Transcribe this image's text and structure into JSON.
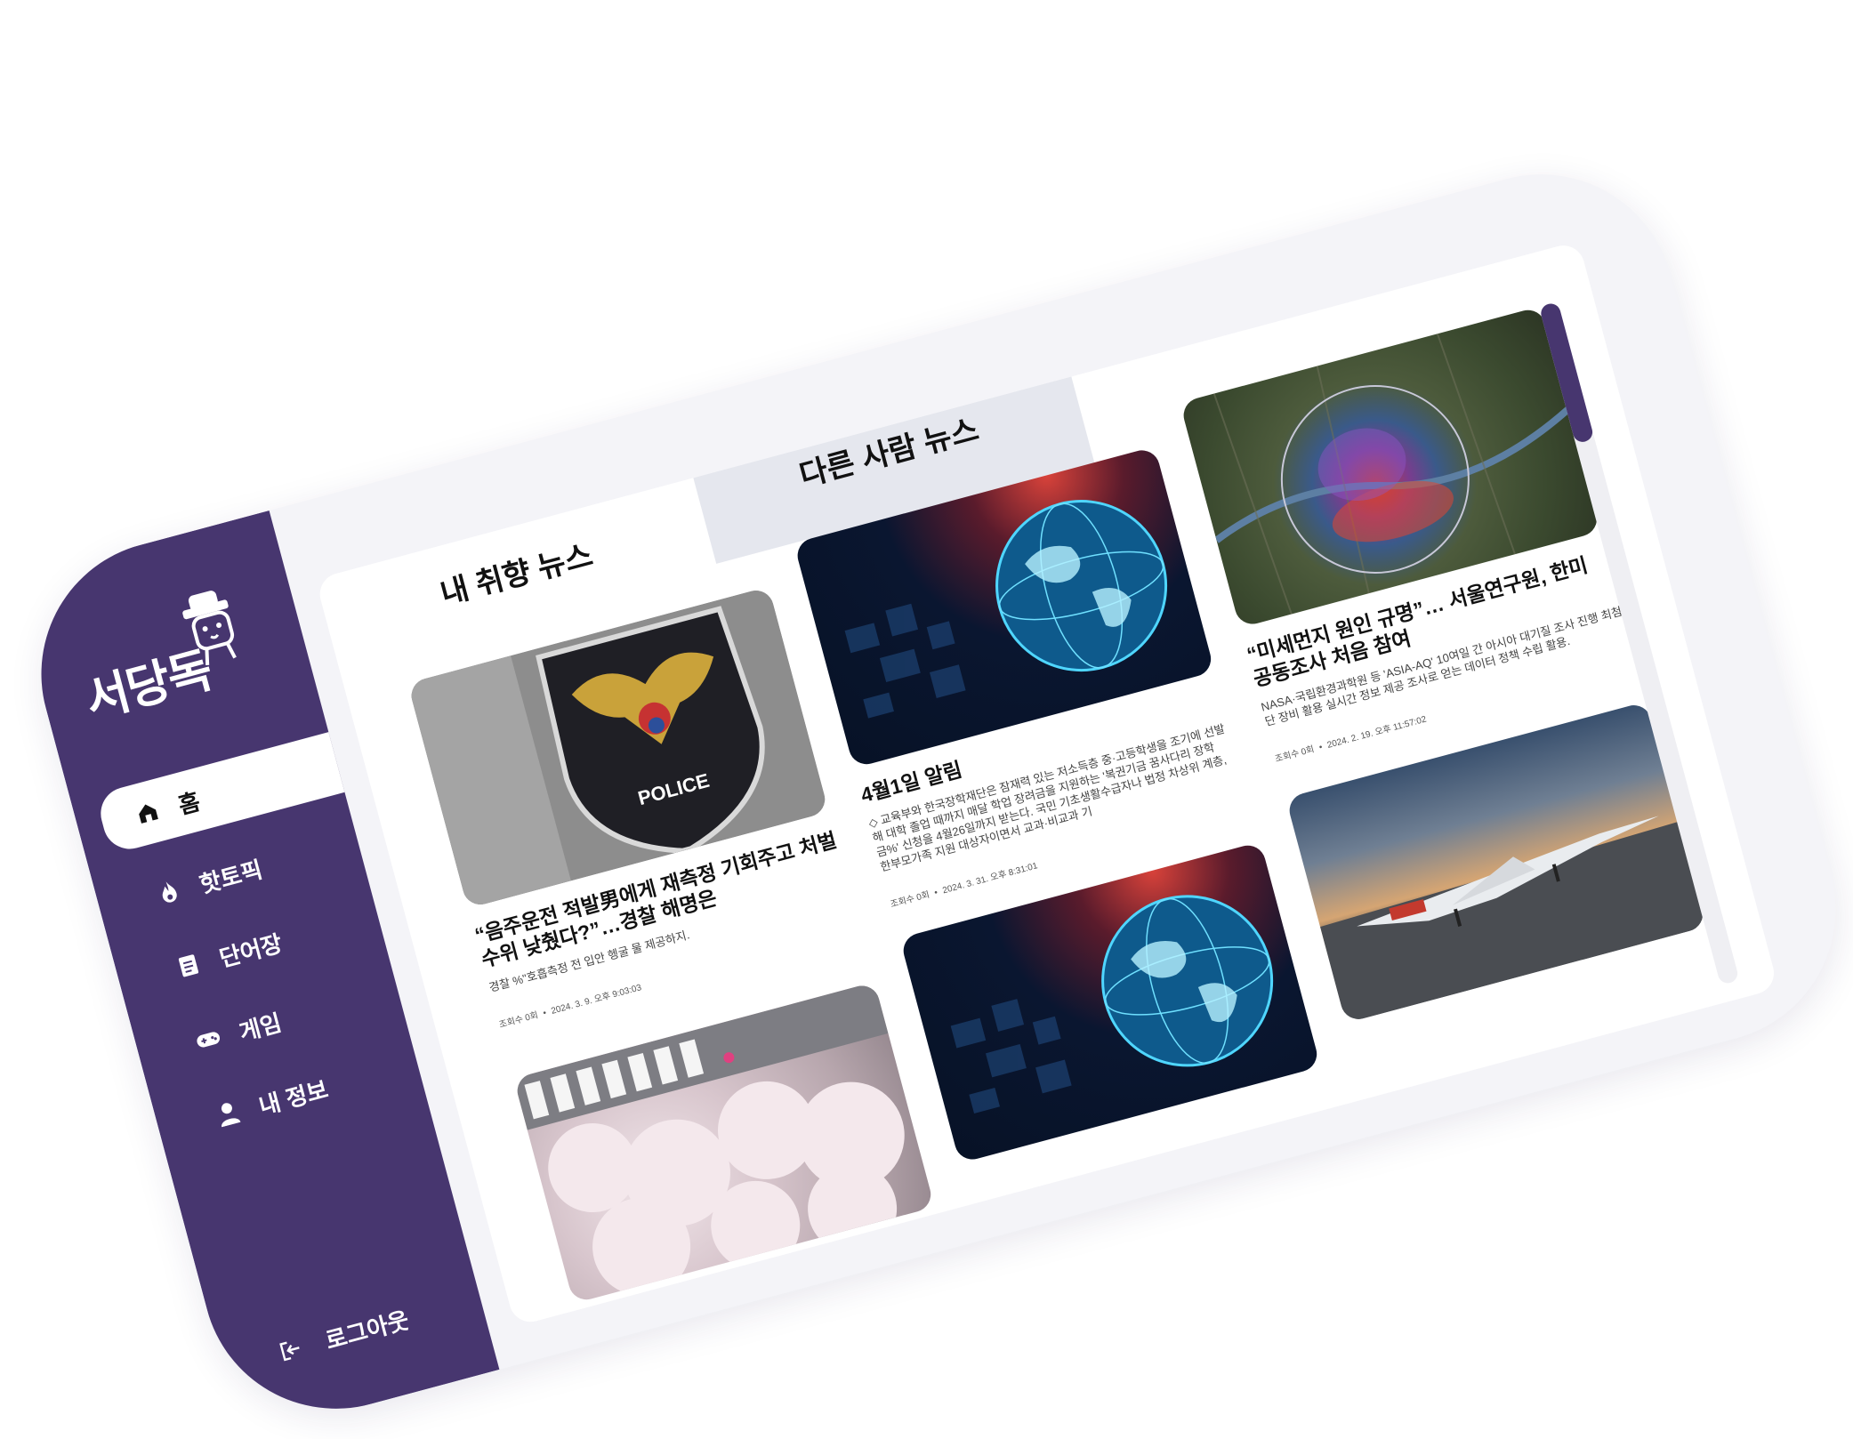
{
  "app": {
    "logo_text": "서당독",
    "colors": {
      "brand": "#47366f",
      "card_bg": "#ffffff",
      "device_bg": "#f4f4f8",
      "tab_inactive_bg": "#e5e7ee"
    }
  },
  "sidebar": {
    "items": [
      {
        "label": "홈",
        "icon": "home-icon"
      },
      {
        "label": "핫토픽",
        "icon": "fire-icon"
      },
      {
        "label": "단어장",
        "icon": "notebook-icon"
      },
      {
        "label": "게임",
        "icon": "gamepad-icon"
      },
      {
        "label": "내 정보",
        "icon": "user-icon"
      }
    ],
    "active_index": 0,
    "logout_label": "로그아웃",
    "logout_icon": "logout-icon"
  },
  "tabs": {
    "my_news": "내 취향 뉴스",
    "others_news": "다른 사람 뉴스"
  },
  "news": [
    {
      "title": "“음주운전 적발男에게 재측정 기회주고 처벌 수위 낮췄다?”…경찰 해명은",
      "summary": "경찰 %\"호흡측정 전 입안 헹굴 물 제공하지.",
      "views": "조회수 0회",
      "date": "2024. 3. 9. 오후 9:03:03",
      "image": "police-patch"
    },
    {
      "title": "4월1일 알림",
      "summary": "◇ 교육부와 한국장학재단은 잠재력 있는 저소득층 중·고등학생을 조기에 선발해 대학 졸업 때까지 매달 학업 장려금을 지원하는 '복권기금 꿈사다리 장학금%' 신청을 4월26일까지 받는다. 국민 기초생활수급자나 법정 차상위 계층, 한부모가족 지원 대상자이면서 교과·비교과 기",
      "views": "조회수 0회",
      "date": "2024. 3. 31. 오후 8:31:01",
      "image": "digital-globe"
    },
    {
      "title": "“미세먼지 원인 규명”… 서울연구원, 한미 공동조사 처음 참여",
      "summary": "NASA·국립환경과학원 등 'ASIA-AQ' 10여일 간 아시아 대기질 조사 진행 최첨단 장비 활용 실시간 정보 제공 조사로 얻는 데이터 정책 수립 활용.",
      "views": "조회수 0회",
      "date": "2024. 2. 19. 오후 11:57:02",
      "image": "seoul-pollution-map"
    },
    {
      "image": "cherry-blossom-street"
    },
    {
      "image": "digital-globe"
    },
    {
      "image": "supersonic-jet"
    }
  ]
}
